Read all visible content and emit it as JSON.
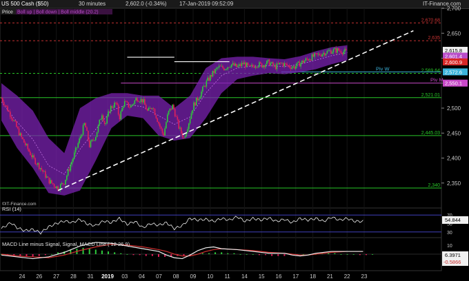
{
  "header": {
    "instrument": "US 500 Cash ($50)",
    "timeframe": "30 minutes",
    "last": "2,602.0 (-0.34%)",
    "datetime": "17-Jan-2019 09:52:09",
    "brand": "IT-Finance.com"
  },
  "main_legend": {
    "price": "Price",
    "boll": "Boll up | Boll down | Boll middle (20.2)"
  },
  "watermark": "©IT-Finance.com",
  "rsi": {
    "title": "RSI (14)",
    "value": "54.844"
  },
  "macd": {
    "title": "MACD Line minus Signal, Signal, MACD Line ( 12 26 9)",
    "v1": "6.3971",
    "v2": "-0.5866"
  },
  "colors": {
    "candle_up": "#2ecc3c",
    "candle_down": "#e0205a",
    "bollinger_fill": "#7a22b0",
    "support": "#28c828",
    "pivot_w": "#3cb4dc",
    "pivot_m": "#c848c8",
    "resistance_dashed": "#c83232"
  },
  "chart_data": {
    "type": "candlestick",
    "x_tick_labels": [
      "24",
      "26",
      "27",
      "28",
      "31",
      "2019",
      "03",
      "04",
      "07",
      "08",
      "09",
      "10",
      "11",
      "14",
      "15",
      "16",
      "17",
      "18",
      "21",
      "22",
      "23"
    ],
    "y_range": [
      2300,
      2700
    ],
    "y_ticks": [
      2350,
      2400,
      2450,
      2500,
      2550,
      2600,
      2650,
      2700
    ],
    "y_tick_labels": [
      "2,350",
      "2,400",
      "2,450",
      "2,500",
      "2,550",
      "2,600",
      "2,650",
      "2,700"
    ],
    "levels": [
      {
        "label": "2,670.68",
        "value": 2670.68,
        "style": "dashed"
      },
      {
        "label": "2,635",
        "value": 2635,
        "style": "dashed"
      },
      {
        "label": "2,569.64",
        "value": 2569.64,
        "style": "dashed"
      },
      {
        "label": "2,521.01",
        "value": 2521.01,
        "style": "solid"
      },
      {
        "label": "2,445.03",
        "value": 2445.03,
        "style": "solid"
      },
      {
        "label": "2,340",
        "value": 2340,
        "style": "solid"
      }
    ],
    "pivots": [
      {
        "label": "Piv W",
        "value": 2572.6
      },
      {
        "label": "Piv M",
        "value": 2550.1
      }
    ],
    "price_badges": [
      {
        "label": "2,615.8",
        "value": 2615.8
      },
      {
        "label": "2,601.4",
        "value": 2601.4
      },
      {
        "label": "2,600.9",
        "value": 2600.9
      },
      {
        "label": "2,572.6",
        "value": 2572.6
      },
      {
        "label": "2,550.1",
        "value": 2550.1
      }
    ],
    "close_path": [
      [
        0,
        2520
      ],
      [
        7,
        2480
      ],
      [
        12,
        2445
      ],
      [
        20,
        2400
      ],
      [
        25,
        2380
      ],
      [
        30,
        2355
      ],
      [
        36,
        2340
      ],
      [
        40,
        2352
      ],
      [
        45,
        2395
      ],
      [
        50,
        2440
      ],
      [
        53,
        2470
      ],
      [
        56,
        2425
      ],
      [
        60,
        2445
      ],
      [
        64,
        2490
      ],
      [
        66,
        2465
      ],
      [
        69,
        2500
      ],
      [
        73,
        2510
      ],
      [
        75,
        2480
      ],
      [
        78,
        2512
      ],
      [
        82,
        2502
      ],
      [
        86,
        2520
      ],
      [
        90,
        2515
      ],
      [
        93,
        2492
      ],
      [
        96,
        2505
      ],
      [
        100,
        2470
      ],
      [
        103,
        2445
      ],
      [
        106,
        2490
      ],
      [
        109,
        2505
      ],
      [
        113,
        2460
      ],
      [
        116,
        2440
      ],
      [
        119,
        2470
      ],
      [
        122,
        2505
      ],
      [
        126,
        2525
      ],
      [
        130,
        2550
      ],
      [
        134,
        2568
      ],
      [
        138,
        2582
      ],
      [
        142,
        2580
      ],
      [
        146,
        2588
      ],
      [
        150,
        2582
      ],
      [
        154,
        2590
      ],
      [
        158,
        2580
      ],
      [
        162,
        2588
      ],
      [
        166,
        2586
      ],
      [
        170,
        2592
      ],
      [
        174,
        2582
      ],
      [
        178,
        2590
      ],
      [
        182,
        2585
      ],
      [
        186,
        2582
      ],
      [
        190,
        2590
      ],
      [
        194,
        2597
      ],
      [
        198,
        2603
      ],
      [
        202,
        2607
      ],
      [
        206,
        2612
      ],
      [
        210,
        2615
      ],
      [
        214,
        2616
      ],
      [
        218,
        2613
      ],
      [
        220,
        2612
      ]
    ],
    "bands": {
      "x": [
        0,
        10,
        20,
        30,
        40,
        50,
        60,
        70,
        80,
        90,
        100,
        110,
        120,
        130,
        140,
        150,
        160,
        170,
        180,
        190,
        200,
        210,
        220
      ],
      "upper": [
        2550,
        2525,
        2495,
        2440,
        2410,
        2500,
        2520,
        2530,
        2530,
        2525,
        2525,
        2500,
        2525,
        2580,
        2600,
        2603,
        2603,
        2600,
        2598,
        2604,
        2614,
        2622,
        2626
      ],
      "lower": [
        2475,
        2420,
        2380,
        2330,
        2325,
        2335,
        2395,
        2460,
        2485,
        2480,
        2445,
        2435,
        2440,
        2480,
        2530,
        2558,
        2565,
        2570,
        2568,
        2572,
        2578,
        2588,
        2596
      ]
    },
    "trendline": [
      [
        36,
        2335
      ],
      [
        262,
        2655
      ]
    ],
    "range_lines": [
      [
        [
          80,
          2602
        ],
        [
          110,
          2602
        ]
      ],
      [
        [
          110,
          2593
        ],
        [
          145,
          2593
        ]
      ]
    ],
    "rsi": {
      "range": [
        20,
        80
      ],
      "ticks": [
        30,
        50,
        70
      ],
      "tick_labels": [
        "30",
        "50",
        "70"
      ],
      "levels": [
        30,
        70
      ],
      "series": [
        [
          0,
          38
        ],
        [
          6,
          52
        ],
        [
          10,
          40
        ],
        [
          15,
          33
        ],
        [
          20,
          36
        ],
        [
          25,
          28
        ],
        [
          30,
          42
        ],
        [
          35,
          50
        ],
        [
          40,
          56
        ],
        [
          45,
          52
        ],
        [
          50,
          60
        ],
        [
          55,
          48
        ],
        [
          60,
          45
        ],
        [
          65,
          56
        ],
        [
          70,
          52
        ],
        [
          75,
          62
        ],
        [
          80,
          48
        ],
        [
          85,
          55
        ],
        [
          90,
          40
        ],
        [
          95,
          50
        ],
        [
          100,
          46
        ],
        [
          105,
          52
        ],
        [
          110,
          38
        ],
        [
          115,
          45
        ],
        [
          120,
          62
        ],
        [
          125,
          58
        ],
        [
          130,
          60
        ],
        [
          135,
          55
        ],
        [
          140,
          62
        ],
        [
          145,
          58
        ],
        [
          150,
          66
        ],
        [
          155,
          55
        ],
        [
          160,
          62
        ],
        [
          165,
          58
        ],
        [
          170,
          63
        ],
        [
          175,
          55
        ],
        [
          180,
          60
        ],
        [
          185,
          52
        ],
        [
          190,
          62
        ],
        [
          195,
          58
        ],
        [
          200,
          62
        ],
        [
          205,
          55
        ],
        [
          210,
          65
        ],
        [
          215,
          58
        ],
        [
          220,
          62
        ],
        [
          225,
          55
        ],
        [
          230,
          55
        ]
      ]
    },
    "macd": {
      "range": [
        -16,
        16
      ],
      "ticks": [
        -10,
        0,
        10
      ],
      "tick_labels": [
        "-10",
        "0",
        "10"
      ],
      "hist": [
        0,
        -1,
        -2,
        -2,
        -3,
        -3,
        -2,
        -1,
        0,
        2,
        3,
        5,
        6,
        7,
        6,
        5,
        4,
        3,
        2,
        1,
        0,
        -1,
        -1,
        -2,
        -2,
        -3,
        -3,
        -3,
        -2,
        -2,
        -1,
        0,
        1,
        1,
        2,
        2,
        1,
        1,
        0,
        0,
        0,
        -1,
        -1,
        -2,
        -2,
        -2,
        -1,
        -1,
        0,
        0,
        0,
        1,
        1,
        1,
        0,
        0,
        0,
        -1,
        -1,
        0
      ],
      "macd": [
        [
          0,
          -1
        ],
        [
          10,
          -3
        ],
        [
          20,
          -5
        ],
        [
          30,
          -3
        ],
        [
          40,
          2
        ],
        [
          50,
          9
        ],
        [
          60,
          13
        ],
        [
          70,
          12
        ],
        [
          80,
          9
        ],
        [
          90,
          6
        ],
        [
          100,
          3
        ],
        [
          105,
          -1
        ],
        [
          110,
          -4
        ],
        [
          115,
          -5
        ],
        [
          120,
          -1
        ],
        [
          125,
          4
        ],
        [
          130,
          7
        ],
        [
          135,
          8
        ],
        [
          140,
          6
        ],
        [
          150,
          5
        ],
        [
          160,
          3
        ],
        [
          170,
          1
        ],
        [
          180,
          1
        ],
        [
          185,
          -1
        ],
        [
          190,
          -2
        ],
        [
          195,
          -1
        ],
        [
          200,
          1
        ],
        [
          210,
          3
        ],
        [
          220,
          3
        ],
        [
          230,
          3
        ]
      ],
      "signal": [
        [
          0,
          0
        ],
        [
          10,
          -2
        ],
        [
          20,
          -3
        ],
        [
          30,
          -4
        ],
        [
          40,
          -1
        ],
        [
          50,
          4
        ],
        [
          60,
          8
        ],
        [
          70,
          11
        ],
        [
          80,
          10
        ],
        [
          90,
          8
        ],
        [
          100,
          5
        ],
        [
          105,
          3
        ],
        [
          110,
          0
        ],
        [
          115,
          -2
        ],
        [
          120,
          -2
        ],
        [
          125,
          0
        ],
        [
          130,
          3
        ],
        [
          135,
          5
        ],
        [
          140,
          6
        ],
        [
          150,
          5
        ],
        [
          160,
          4
        ],
        [
          170,
          2
        ],
        [
          180,
          1
        ],
        [
          185,
          0
        ],
        [
          190,
          -1
        ],
        [
          195,
          -1
        ],
        [
          200,
          0
        ],
        [
          210,
          2
        ],
        [
          220,
          3
        ],
        [
          230,
          3
        ]
      ]
    }
  }
}
